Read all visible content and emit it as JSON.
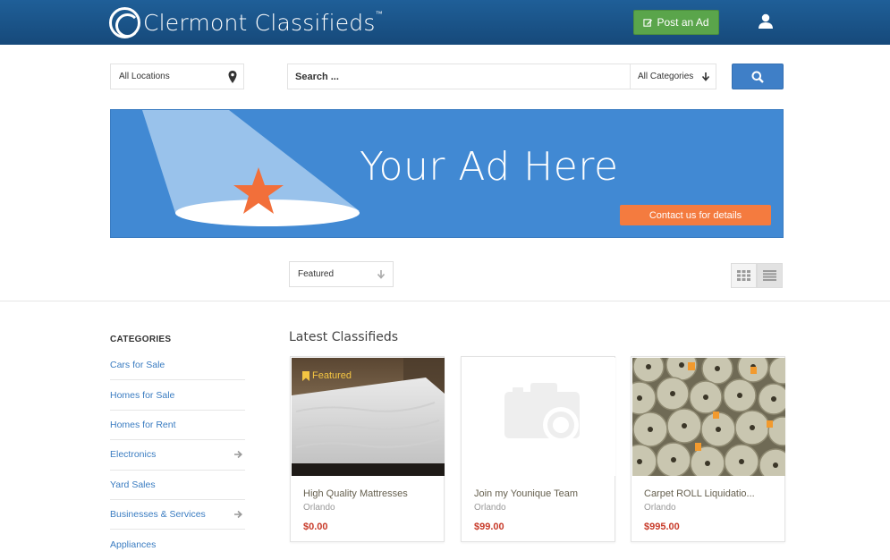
{
  "header": {
    "logo_text": "Clermont Classifieds",
    "logo_tm": "™",
    "post_ad_label": "Post an Ad"
  },
  "search": {
    "location_value": "All Locations",
    "query_placeholder": "Search ...",
    "category_value": "All Categories"
  },
  "banner": {
    "title": "Your Ad Here",
    "cta_label": "Contact us for details"
  },
  "sort": {
    "selected": "Featured"
  },
  "sidebar": {
    "heading": "CATEGORIES",
    "items": [
      {
        "label": "Cars for Sale",
        "has_arrow": false
      },
      {
        "label": "Homes for Sale",
        "has_arrow": false
      },
      {
        "label": "Homes for Rent",
        "has_arrow": false
      },
      {
        "label": "Electronics",
        "has_arrow": true
      },
      {
        "label": "Yard Sales",
        "has_arrow": false
      },
      {
        "label": "Businesses & Services",
        "has_arrow": true
      },
      {
        "label": "Appliances",
        "has_arrow": false
      }
    ]
  },
  "listings": {
    "title": "Latest Classifieds",
    "items": [
      {
        "title": "High Quality Mattresses",
        "location": "Orlando",
        "price": "$0.00",
        "badge": "Featured",
        "image": "mattress-photo"
      },
      {
        "title": "Join my Younique Team",
        "location": "Orlando",
        "price": "$99.00",
        "badge": "",
        "image": "camera-placeholder-icon"
      },
      {
        "title": "Carpet ROLL Liquidatio...",
        "location": "Orlando",
        "price": "$995.00",
        "badge": "",
        "image": "carpet-rolls-photo"
      }
    ]
  },
  "colors": {
    "header": "#1a5487",
    "post_button": "#5aa54b",
    "search_button": "#3f7fc7",
    "banner": "#4189d3",
    "cta": "#f47b3f",
    "link": "#3a7cc1",
    "price": "#c83b2a"
  }
}
